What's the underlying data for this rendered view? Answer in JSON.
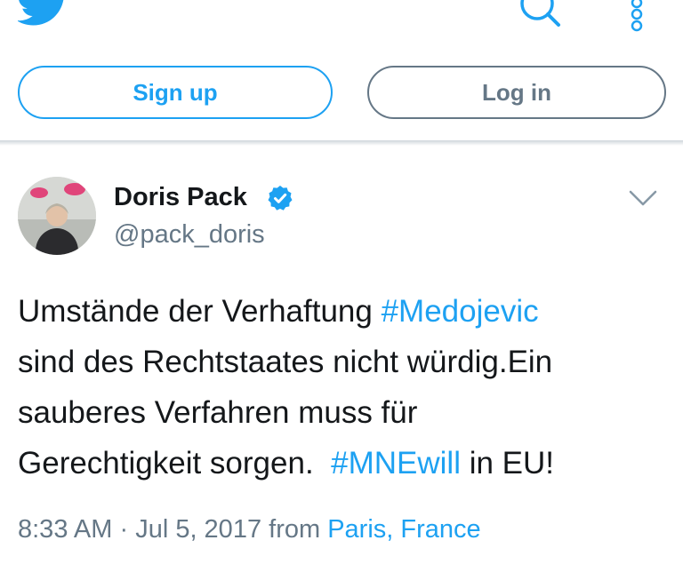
{
  "header": {
    "logo_icon": "twitter-bird-icon",
    "search_icon": "search-icon",
    "more_icon": "more-vertical-icon",
    "signup_label": "Sign up",
    "login_label": "Log in",
    "brand_color": "#1da1f2",
    "muted_color": "#657786"
  },
  "tweet": {
    "author": {
      "display_name": "Doris Pack",
      "handle": "@pack_doris",
      "verified_icon": "verified-badge-icon",
      "avatar_icon": "avatar-photo"
    },
    "options_icon": "chevron-down-icon",
    "text": {
      "line1_text": "Umstände der Verhaftung ",
      "hashtag1": "#Medojevic",
      "line2": "sind des Rechtstaates nicht würdig.Ein",
      "line3": "sauberes Verfahren muss für",
      "line4_text": "Gerechtigkeit sorgen.  ",
      "hashtag2": "#MNEwill",
      "line4_tail": " in EU!"
    },
    "meta": {
      "time": "8:33 AM",
      "separator": " · ",
      "date": "Jul 5, 2017",
      "from": " from ",
      "place": "Paris, France"
    }
  }
}
